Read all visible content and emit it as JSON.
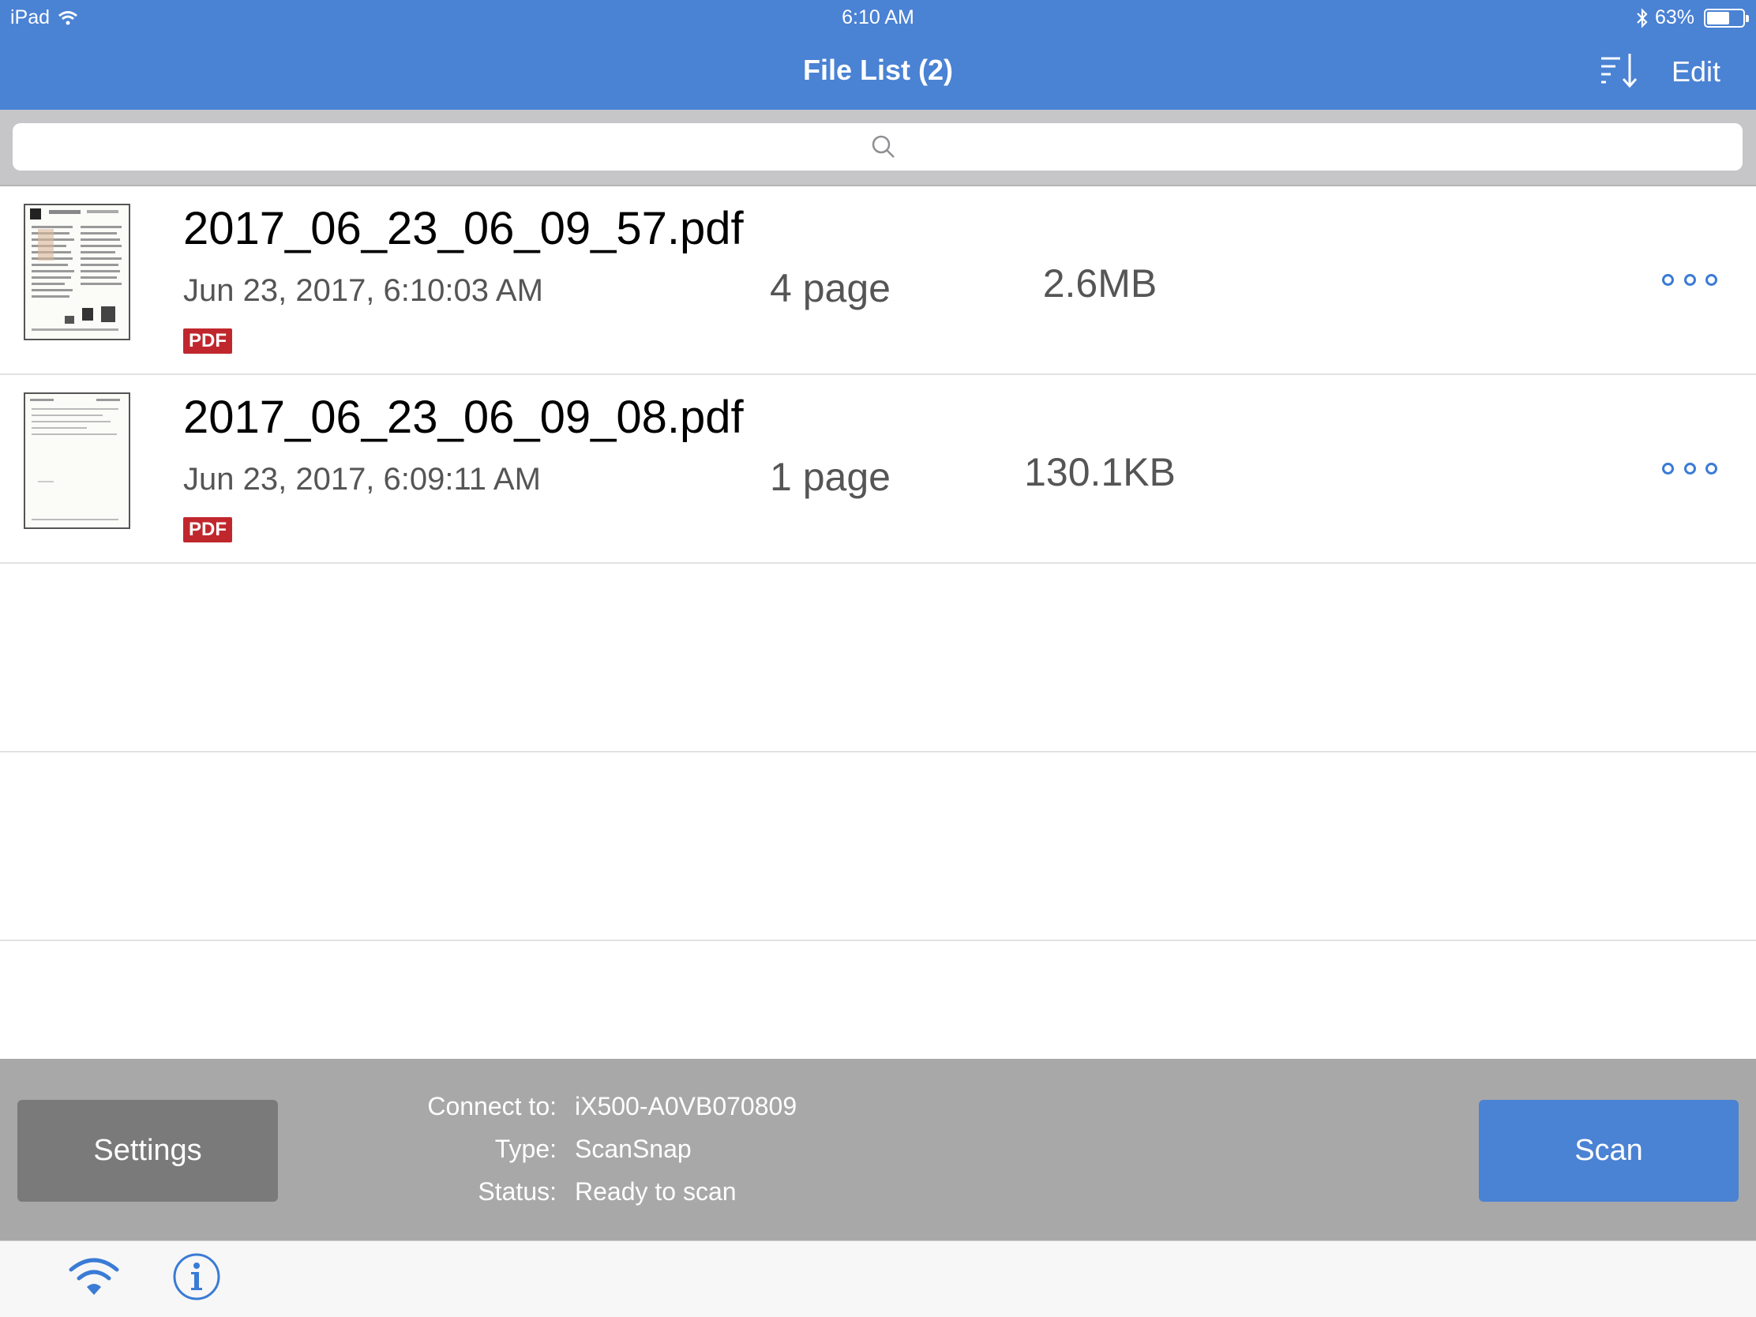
{
  "status_bar": {
    "device": "iPad",
    "time": "6:10 AM",
    "battery_percent": "63%",
    "battery_level": 0.63,
    "icons": [
      "wifi-icon",
      "bluetooth-icon",
      "battery-icon"
    ]
  },
  "nav": {
    "title": "File List (2)",
    "sort_icon": "sort-icon",
    "edit_label": "Edit"
  },
  "search": {
    "placeholder": "",
    "icon": "search-icon"
  },
  "files": [
    {
      "name": "2017_06_23_06_09_57.pdf",
      "date": "Jun 23, 2017, 6:10:03 AM",
      "type_badge": "PDF",
      "pages": "4 page",
      "size": "2.6MB"
    },
    {
      "name": "2017_06_23_06_09_08.pdf",
      "date": "Jun 23, 2017, 6:09:11 AM",
      "type_badge": "PDF",
      "pages": "1 page",
      "size": "130.1KB"
    }
  ],
  "panel": {
    "settings_label": "Settings",
    "scan_label": "Scan",
    "connect_label": "Connect to:",
    "connect_value": "iX500-A0VB070809",
    "type_label": "Type:",
    "type_value": "ScanSnap",
    "status_label": "Status:",
    "status_value": "Ready to scan"
  },
  "tabbar": {
    "icons": [
      "wifi-icon",
      "info-icon"
    ]
  },
  "colors": {
    "accent": "#4a82d4",
    "panel": "#a8a8a8",
    "settings_button": "#7a7a7a",
    "pdf_badge": "#c0272d"
  }
}
